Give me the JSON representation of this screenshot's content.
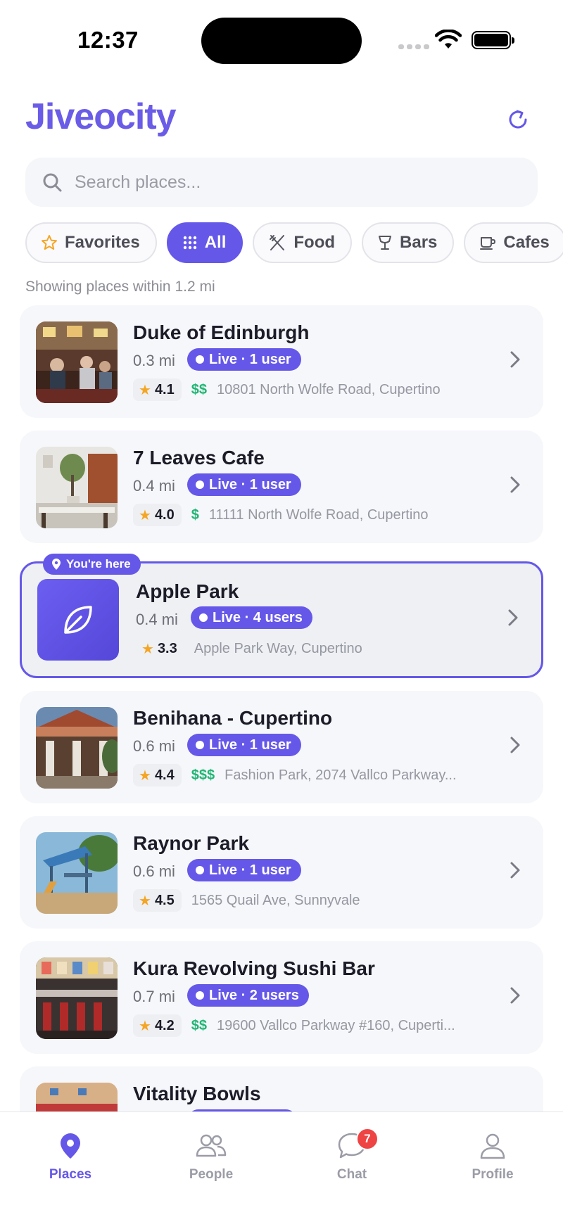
{
  "status_bar": {
    "time": "12:37"
  },
  "header": {
    "title": "Jiveocity"
  },
  "search": {
    "placeholder": "Search places..."
  },
  "filters": [
    {
      "label": "Favorites",
      "icon": "star-outline-icon",
      "active": false
    },
    {
      "label": "All",
      "icon": "grid-icon",
      "active": true
    },
    {
      "label": "Food",
      "icon": "utensils-icon",
      "active": false
    },
    {
      "label": "Bars",
      "icon": "cocktail-icon",
      "active": false
    },
    {
      "label": "Cafes",
      "icon": "coffee-cup-icon",
      "active": false
    }
  ],
  "range_note": "Showing places within 1.2 mi",
  "places": [
    {
      "name": "Duke of Edinburgh",
      "distance": "0.3 mi",
      "live": "Live · 1 user",
      "rating": "4.1",
      "price": "$$",
      "address": "10801 North Wolfe Road, Cupertino"
    },
    {
      "name": "7 Leaves Cafe",
      "distance": "0.4 mi",
      "live": "Live · 1 user",
      "rating": "4.0",
      "price": "$",
      "address": "11111 North Wolfe Road, Cupertino"
    },
    {
      "name": "Apple Park",
      "distance": "0.4 mi",
      "live": "Live · 4 users",
      "rating": "3.3",
      "price": "",
      "address": "Apple Park Way, Cupertino",
      "here_label": "You're here"
    },
    {
      "name": "Benihana - Cupertino",
      "distance": "0.6 mi",
      "live": "Live · 1 user",
      "rating": "4.4",
      "price": "$$$",
      "address": "Fashion Park, 2074 Vallco Parkway..."
    },
    {
      "name": "Raynor Park",
      "distance": "0.6 mi",
      "live": "Live · 1 user",
      "rating": "4.5",
      "price": "",
      "address": "1565 Quail Ave, Sunnyvale"
    },
    {
      "name": "Kura Revolving Sushi Bar",
      "distance": "0.7 mi",
      "live": "Live · 2 users",
      "rating": "4.2",
      "price": "$$",
      "address": "19600 Vallco Parkway #160, Cuperti..."
    },
    {
      "name": "Vitality Bowls",
      "distance": "",
      "live": "",
      "rating": "",
      "price": "",
      "address": ""
    }
  ],
  "tabs": [
    {
      "label": "Places",
      "icon": "map-pin-icon",
      "active": true
    },
    {
      "label": "People",
      "icon": "people-icon",
      "active": false
    },
    {
      "label": "Chat",
      "icon": "chat-bubble-icon",
      "active": false,
      "badge": "7"
    },
    {
      "label": "Profile",
      "icon": "person-icon",
      "active": false
    }
  ],
  "colors": {
    "accent": "#6558e8",
    "price": "#21b574",
    "star": "#f5a524",
    "badge": "#ef4444"
  }
}
